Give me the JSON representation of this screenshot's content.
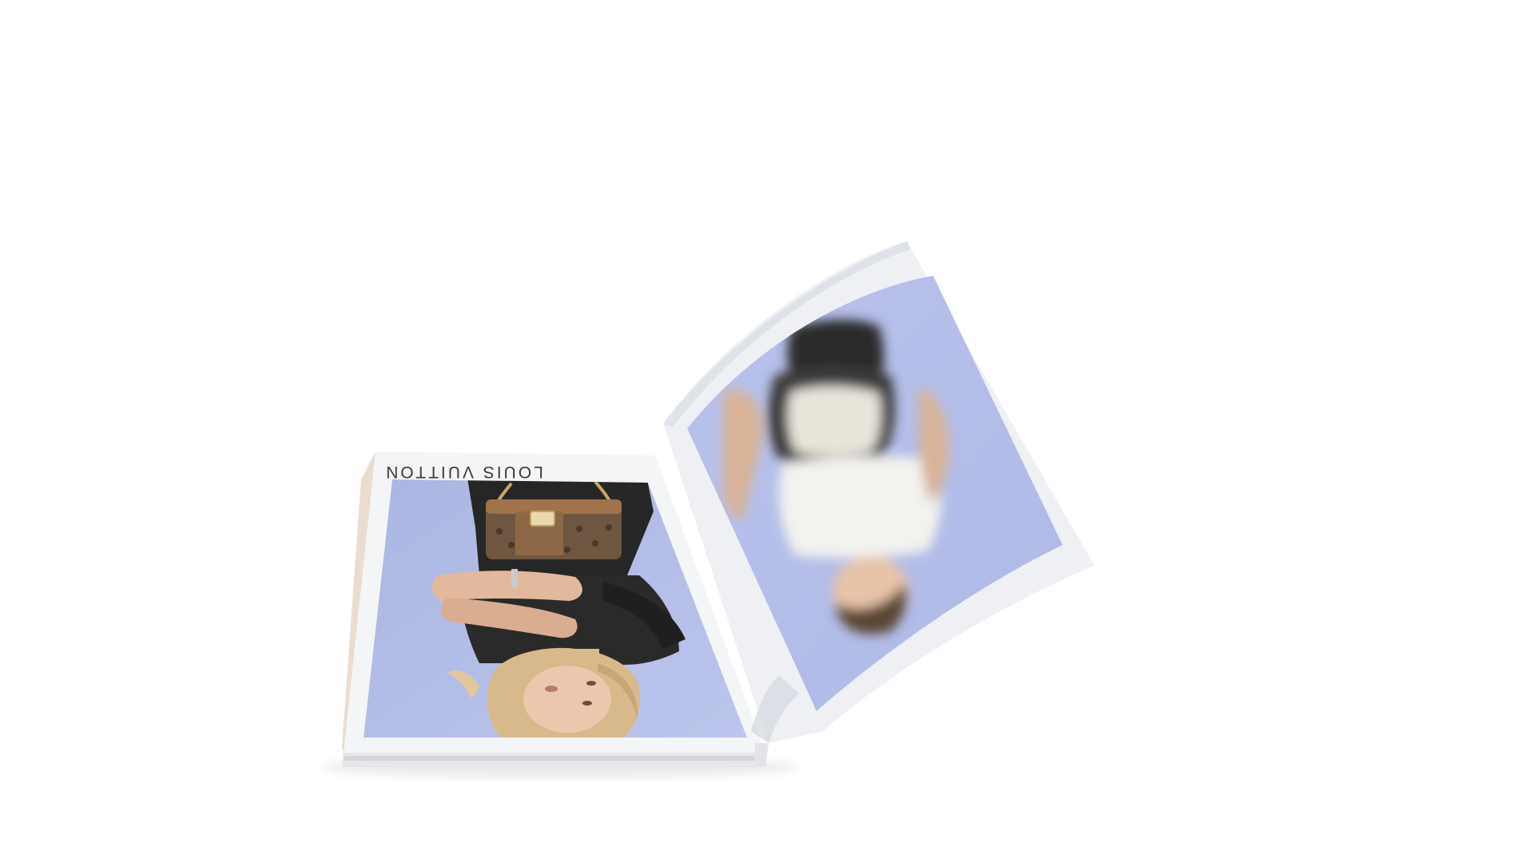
{
  "scene": {
    "background_color": "#ffffff",
    "subject": "open-magazine",
    "orientation": "upside-down"
  },
  "left_page": {
    "brand_text": "LOUIS VUITTON",
    "photo_background_color": "#b2bde6",
    "paper_color": "#f4f5f7"
  },
  "right_page": {
    "photo_background_color": "#b6c0ea",
    "paper_color": "#f6f7f9"
  },
  "colors": {
    "blonde_hair": "#d8b98c",
    "black_outfit": "#262626",
    "handbag_monogram": "#6e5640",
    "handbag_trim": "#a0734a",
    "white_top": "#f2f2ef",
    "dark_hair": "#5c4636",
    "skin": "#e7c3a8"
  }
}
